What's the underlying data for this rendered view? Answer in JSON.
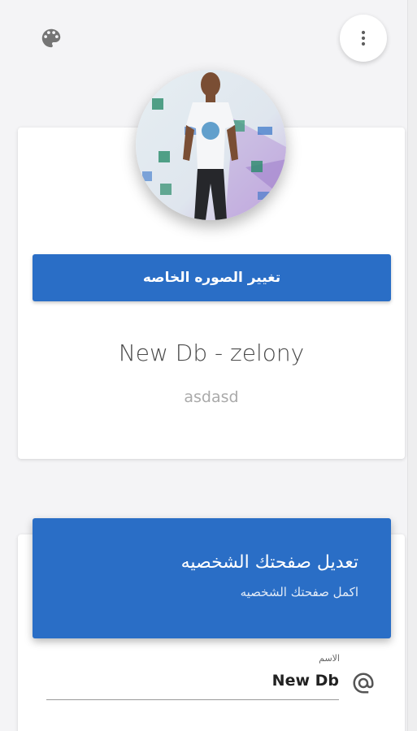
{
  "toolbar": {
    "palette_icon": "palette-icon",
    "more_icon": "more-vert-icon"
  },
  "profile": {
    "change_photo_label": "تغيير الصوره الخاصه",
    "name": "New Db - zelony",
    "subtitle": "asdasd"
  },
  "edit_profile": {
    "title": "تعديل صفحتك الشخصيه",
    "subtitle": "اكمل صفحتك الشخصيه",
    "name_field": {
      "label": "الاسم",
      "value": "New Db",
      "icon": "at-sign-icon"
    }
  },
  "colors": {
    "primary": "#2a6ec6",
    "background": "#f4f4f6",
    "card": "#ffffff"
  }
}
